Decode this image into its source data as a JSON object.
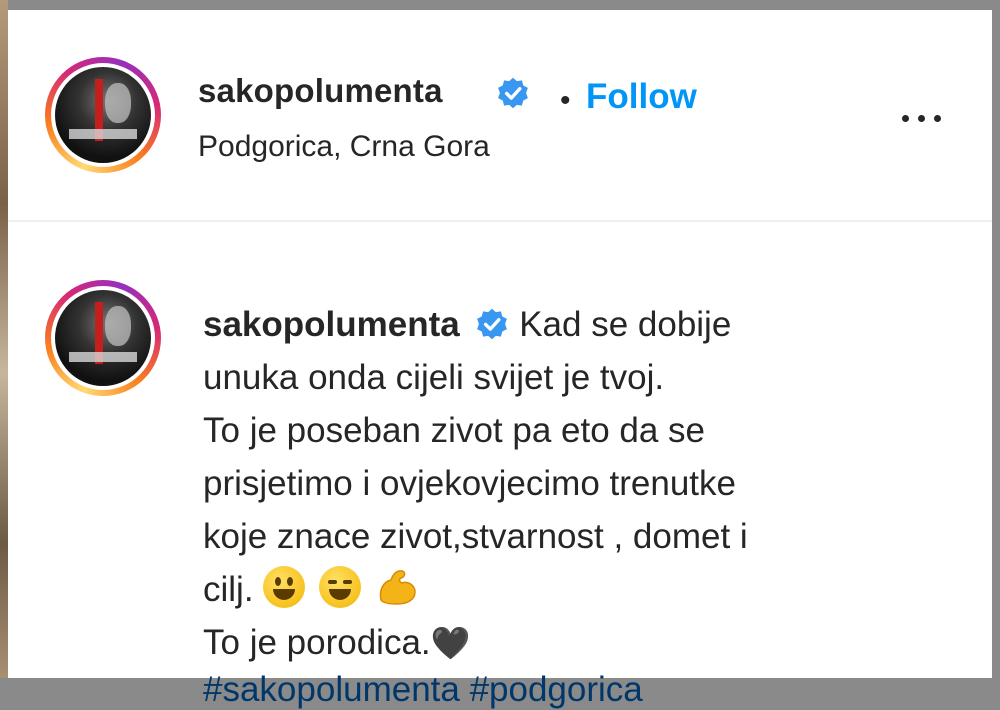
{
  "post": {
    "username": "sakopolumenta",
    "separator": "•",
    "follow_label": "Follow",
    "location": "Podgorica, Crna Gora",
    "more_label": "More options"
  },
  "caption": {
    "username": "sakopolumenta",
    "line1": " Kad se dobije",
    "line2": "unuka onda cijeli svijet je tvoj.",
    "line3": "To je poseban zivot pa eto da se",
    "line4": "prisjetimo i ovjekovjecimo trenutke",
    "line5": "koje znace zivot,stvarnost , domet i",
    "line6": "cilj. ",
    "line7": "To je porodica.",
    "heart": "🖤",
    "hashtags": "#sakopolumenta #podgorica"
  },
  "colors": {
    "link_blue": "#0095f6",
    "verified_blue": "#3897f0",
    "text": "#262626",
    "divider": "#efefef"
  },
  "icons": [
    "verified-badge-icon",
    "more-options-icon",
    "grinning-face-emoji",
    "laughing-face-emoji",
    "flexed-biceps-emoji",
    "black-heart-emoji"
  ]
}
